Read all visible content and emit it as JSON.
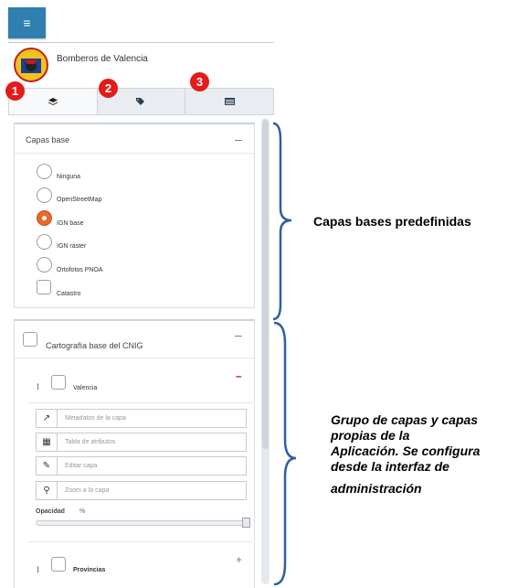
{
  "header": {
    "menu_icon": "hamburger-icon",
    "brand_name": "Bomberos de Valencia",
    "brand_logo": "fire-department-crest"
  },
  "tabs": [
    {
      "icon": "layers-icon",
      "badge": "1"
    },
    {
      "icon": "tags-icon",
      "badge": "2"
    },
    {
      "icon": "list-window-icon",
      "badge": "3"
    }
  ],
  "base_layers": {
    "title": "Capas base",
    "collapse_symbol": "–",
    "options": [
      {
        "label": "Ninguna",
        "control": "radio",
        "selected": false
      },
      {
        "label": "OpenStreetMap",
        "control": "radio",
        "selected": false
      },
      {
        "label": "IGN base",
        "control": "radio",
        "selected": true
      },
      {
        "label": "IGN ráster",
        "control": "radio",
        "selected": false
      },
      {
        "label": "Ortofotos PNOA",
        "control": "radio",
        "selected": false
      },
      {
        "label": "Catastro",
        "control": "checkbox",
        "selected": false
      }
    ]
  },
  "group": {
    "title": "Cartografía base del CNIG",
    "collapse_symbol": "–",
    "layer": {
      "name": "Valencia",
      "collapse_symbol": "–",
      "drag_symbol": "⁞",
      "actions": [
        {
          "label": "Metadatos de la capa",
          "icon": "external-link-icon",
          "glyph": "↗"
        },
        {
          "label": "Tabla de atributos",
          "icon": "table-icon",
          "glyph": "▦"
        },
        {
          "label": "Editar capa",
          "icon": "edit-icon",
          "glyph": "✎"
        },
        {
          "label": "Zoom a la capa",
          "icon": "search-icon",
          "glyph": "⚲"
        }
      ],
      "opacity_label": "Opacidad",
      "opacity_unit": "%",
      "opacity_value": 1.0
    },
    "layer2": {
      "name": "Provincias",
      "expand_symbol": "+",
      "drag_symbol": "⁞"
    }
  },
  "annotations": {
    "a1": "Capas bases predefinidas",
    "a2_lines": [
      "Grupo de capas y capas",
      "propias de la",
      "Aplicación. Se configura",
      "desde la interfaz de",
      "administración"
    ]
  },
  "colors": {
    "accent": "#2f7fb0",
    "badge": "#e31b1b",
    "radio_selected": "#e86a2b",
    "brace": "#2f5f9e"
  }
}
